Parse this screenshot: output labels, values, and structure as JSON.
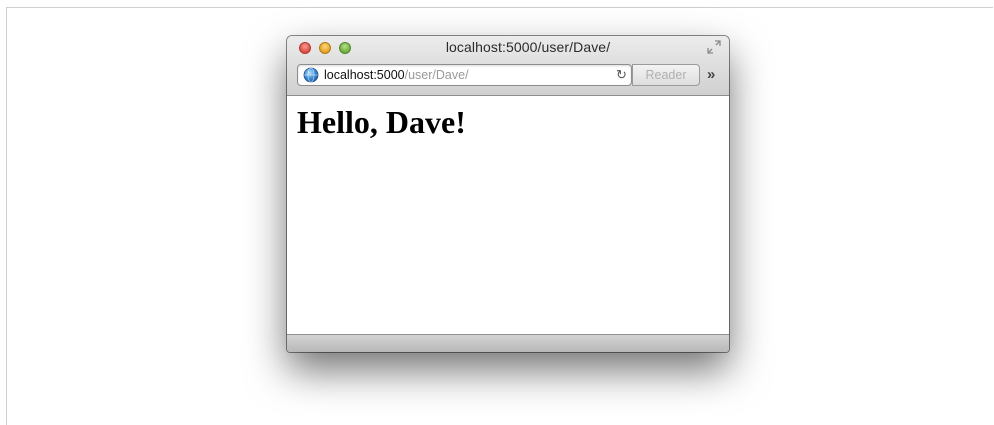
{
  "window": {
    "title": "localhost:5000/user/Dave/"
  },
  "toolbar": {
    "url_host": "localhost:5000",
    "url_path": "/user/Dave/",
    "reload_glyph": "↻",
    "reader_label": "Reader",
    "more_glyph": "»"
  },
  "page": {
    "heading": "Hello, Dave!"
  },
  "icons": {
    "close": "close-traffic-light-icon",
    "minimize": "minimize-traffic-light-icon",
    "zoom": "zoom-traffic-light-icon",
    "fullscreen": "fullscreen-arrows-icon",
    "site": "globe-icon",
    "reload": "reload-icon",
    "more": "chevron-double-right-icon"
  },
  "colors": {
    "close": "#dc4a3f",
    "minimize": "#e3a125",
    "zoom": "#70ab3b"
  }
}
